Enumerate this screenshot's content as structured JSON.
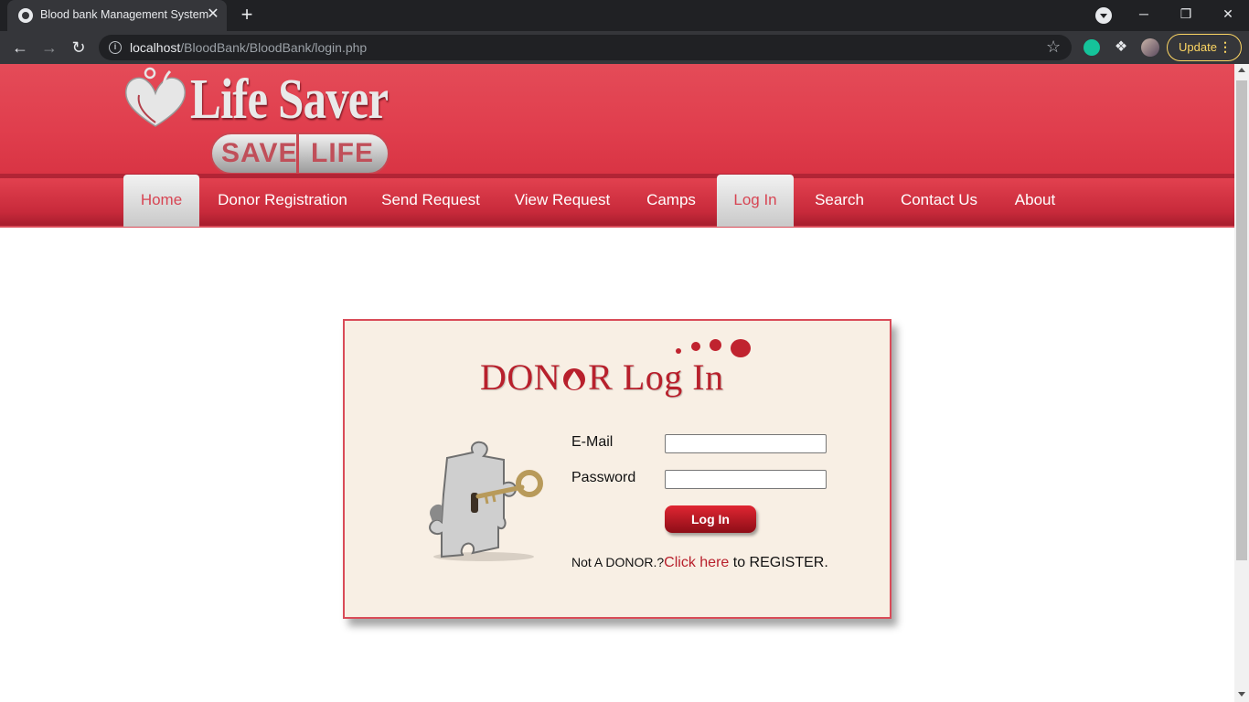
{
  "browser": {
    "tab_title": "Blood bank Management System",
    "tab_close": "✕",
    "new_tab": "+",
    "url_host": "localhost",
    "url_path": "/BloodBank/BloodBank/login.php",
    "update_label": "Update",
    "menu_dots": "⋮",
    "window_controls": [
      "─",
      "❐",
      "✕"
    ]
  },
  "header": {
    "logo_title": "Life Saver",
    "logo_badge_left": "SAVE",
    "logo_badge_right": "LIFE"
  },
  "nav": {
    "items": [
      {
        "label": "Home",
        "active": true
      },
      {
        "label": "Donor Registration",
        "active": false
      },
      {
        "label": "Send Request",
        "active": false
      },
      {
        "label": "View Request",
        "active": false
      },
      {
        "label": "Camps",
        "active": false
      },
      {
        "label": "Log In",
        "active": true
      },
      {
        "label": "Search",
        "active": false
      },
      {
        "label": "Contact Us",
        "active": false
      },
      {
        "label": "About",
        "active": false
      }
    ]
  },
  "login": {
    "title_left": "DON",
    "title_right": "R Log In",
    "email_label": "E-Mail",
    "email_value": "",
    "password_label": "Password",
    "password_value": "",
    "button_label": "Log In",
    "register_prefix": "Not A DONOR.?",
    "register_link": "Click here",
    "register_suffix": " to REGISTER."
  },
  "colors": {
    "brand_red": "#e03e4d",
    "accent_dark_red": "#b8202c",
    "box_background": "#f8efe4"
  }
}
